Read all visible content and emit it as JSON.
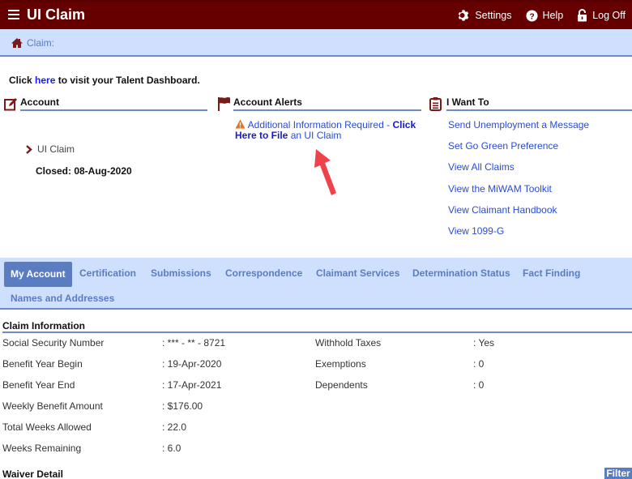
{
  "header": {
    "app_title": "UI Claim",
    "menu_icon": "hamburger-menu-icon",
    "actions": [
      {
        "label": "Settings",
        "icon": "gear-icon"
      },
      {
        "label": "Help",
        "icon": "question-circle-icon"
      },
      {
        "label": "Log Off",
        "icon": "lock-icon"
      }
    ]
  },
  "breadcrumb": {
    "icon": "home-icon",
    "label": "Claim:"
  },
  "dashboard_notice": {
    "prefix": "Click ",
    "link": "here",
    "suffix": " to visit your Talent Dashboard."
  },
  "account": {
    "title": "Account",
    "icon": "edit-square-icon",
    "claim_label": "UI Claim",
    "claim_status": "Closed: 08-Aug-2020"
  },
  "alerts": {
    "title": "Account Alerts",
    "icon": "flag-icon",
    "items": [
      {
        "icon": "warning-triangle-icon",
        "text_prefix": "Additional Information Required - ",
        "link_bold": "Click Here to File",
        "text_suffix": " an UI Claim"
      }
    ]
  },
  "i_want_to": {
    "title": "I Want To",
    "icon": "clipboard-icon",
    "links": [
      "Send Unemployment a Message",
      "Set Go Green Preference",
      "View All Claims",
      "View the MiWAM Toolkit",
      "View Claimant Handbook",
      "View 1099-G"
    ]
  },
  "tabs": [
    {
      "label": "My Account",
      "active": true
    },
    {
      "label": "Certification",
      "active": false
    },
    {
      "label": "Submissions",
      "active": false
    },
    {
      "label": "Correspondence",
      "active": false
    },
    {
      "label": "Claimant Services",
      "active": false
    },
    {
      "label": "Determination Status",
      "active": false
    },
    {
      "label": "Fact Finding",
      "active": false
    },
    {
      "label": "Names and Addresses",
      "active": false
    }
  ],
  "claim_information": {
    "title": "Claim Information",
    "left": [
      {
        "label": "Social Security Number",
        "value": ": *** - ** - 8721"
      },
      {
        "label": "Benefit Year Begin",
        "value": ": 19-Apr-2020"
      },
      {
        "label": "Benefit Year End",
        "value": ": 17-Apr-2021"
      },
      {
        "label": "Weekly Benefit Amount",
        "value": ": $176.00"
      },
      {
        "label": "Total Weeks Allowed",
        "value": ": 22.0"
      },
      {
        "label": "Weeks Remaining",
        "value": ": 6.0"
      }
    ],
    "right": [
      {
        "label": "Withhold Taxes",
        "value": ": Yes"
      },
      {
        "label": "Exemptions",
        "value": ": 0"
      },
      {
        "label": "Dependents",
        "value": ": 0"
      }
    ]
  },
  "waiver_detail": {
    "title": "Waiver Detail",
    "filter_label": "Filter"
  },
  "colors": {
    "header_bg": "#660000",
    "nav_bg": "#cfe0ff",
    "accent": "#5a7cc0",
    "link": "#2a4bd6",
    "icon_maroon": "#7a1a1a",
    "warning": "#e8711a",
    "annotation_arrow": "#f0424a"
  }
}
